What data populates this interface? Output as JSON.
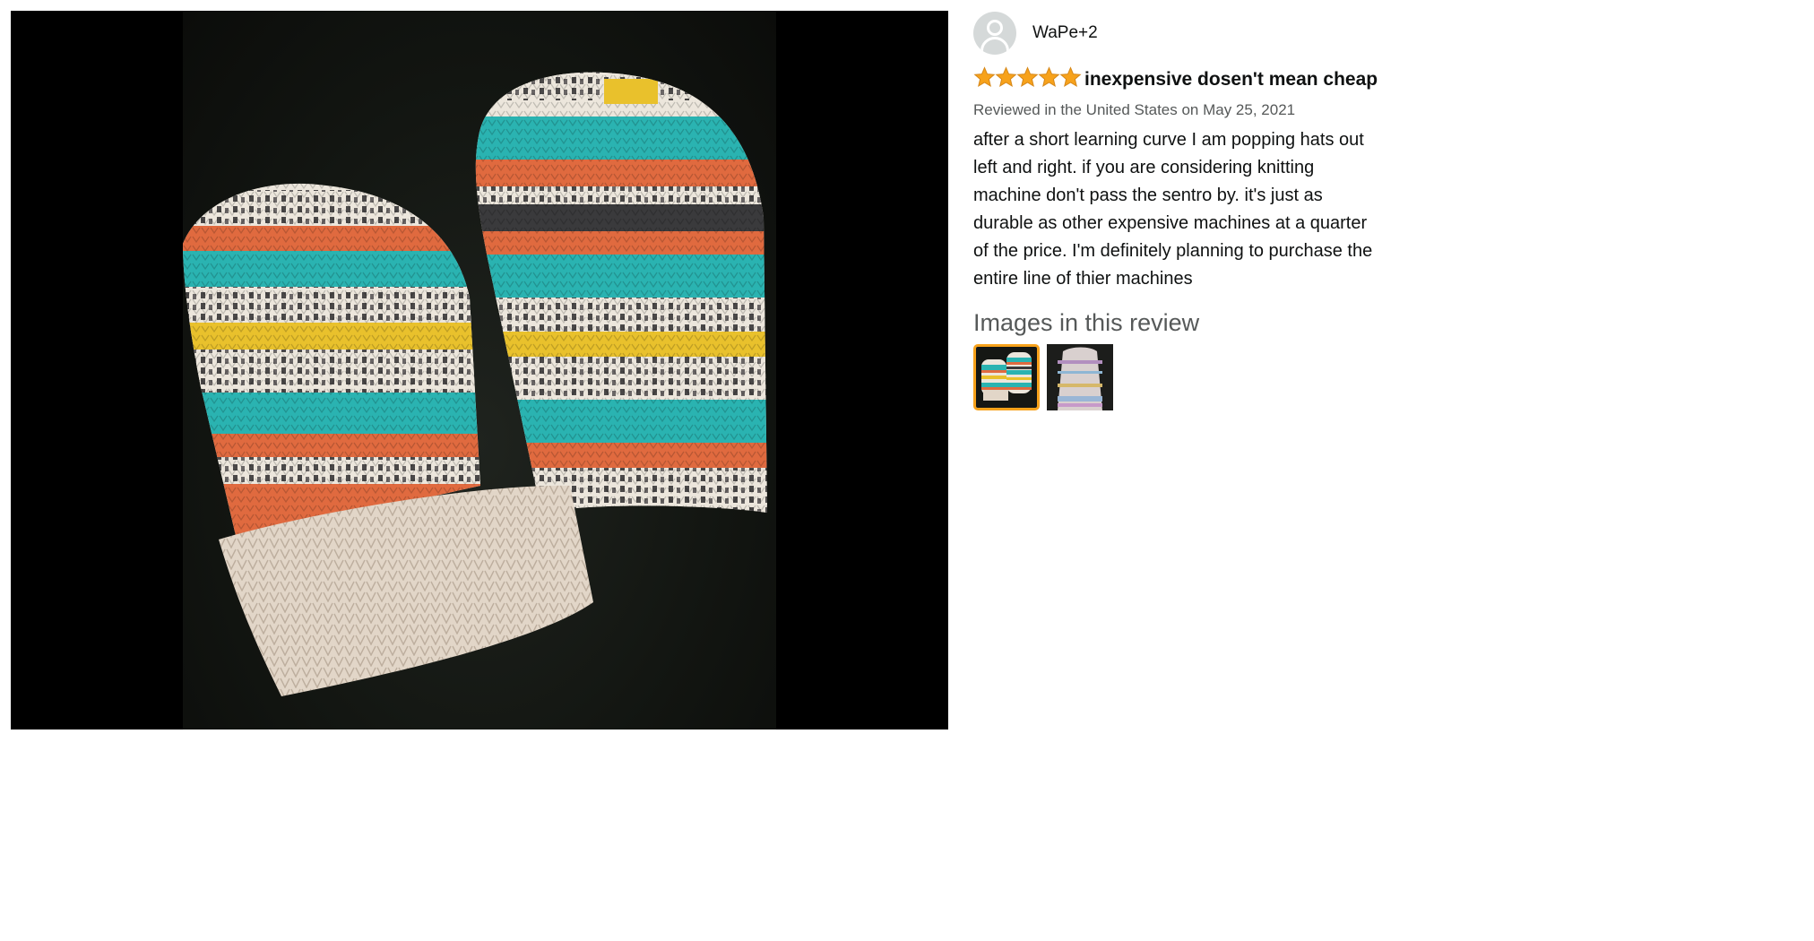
{
  "viewer": {
    "image_alt": "Two striped knitted hats"
  },
  "review": {
    "reviewer_name": "WaPe+2",
    "avatar_icon": "user-avatar-icon",
    "rating": 5,
    "rating_max": 5,
    "star_color": "#f7a21b",
    "title": "inexpensive dosen't mean cheap",
    "date_line": "Reviewed in the United States on May 25, 2021",
    "body": "after a short learning curve I am popping hats out left and right. if you are considering knitting machine don't pass the sentro by. it's just as durable as other expensive machines at a quarter of the price. I'm definitely planning to purchase the entire line of thier machines"
  },
  "images_section": {
    "heading": "Images in this review",
    "thumbnails": [
      {
        "name": "thumbnail-1",
        "selected": true
      },
      {
        "name": "thumbnail-2",
        "selected": false
      }
    ],
    "selected_border_color": "#f7a21b"
  }
}
